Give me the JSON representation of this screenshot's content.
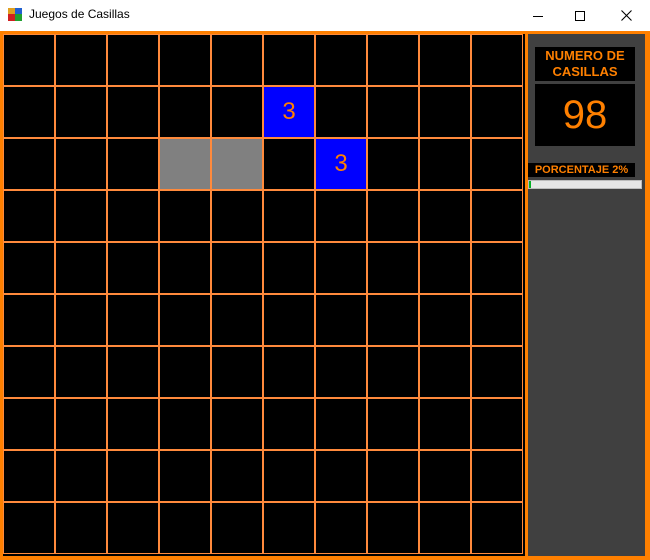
{
  "window": {
    "title": "Juegos de Casillas",
    "minimize_icon": "minimize-icon",
    "maximize_icon": "maximize-icon",
    "close_icon": "close-icon"
  },
  "board": {
    "rows": 10,
    "cols": 10,
    "revealed_cells": [
      {
        "row": 1,
        "col": 5,
        "state": "number",
        "value": "3"
      },
      {
        "row": 2,
        "col": 3,
        "state": "empty",
        "value": ""
      },
      {
        "row": 2,
        "col": 4,
        "state": "empty",
        "value": ""
      },
      {
        "row": 2,
        "col": 6,
        "state": "number",
        "value": "3"
      }
    ],
    "colors": {
      "hidden": "#000000",
      "number_bg": "#0000ff",
      "empty_bg": "#808080",
      "grid": "#ff8a3c",
      "text": "#ff8000"
    }
  },
  "panel": {
    "count_title": "NUMERO DE CASILLAS",
    "count_value": "98",
    "percent_label": "PORCENTAJE 2%",
    "progress_fraction": 0.02
  },
  "colors": {
    "frame": "#ff8000",
    "panel_bg": "#404040",
    "progress_fill": "#06b025"
  }
}
